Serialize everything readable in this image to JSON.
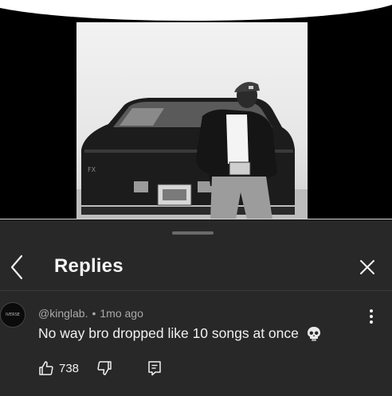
{
  "video": {
    "plate_text": "FX"
  },
  "header": {
    "title": "Replies",
    "back_icon": "chevron-left-icon",
    "close_icon": "close-icon"
  },
  "comment": {
    "avatar_text": "IVERSE",
    "author": "@kinglab.",
    "separator": "•",
    "time": "1mo ago",
    "text": "No way bro dropped like 10 songs at once",
    "emoji_icon": "skull-icon",
    "likes": "738",
    "more_icon": "more-vertical-icon"
  },
  "colors": {
    "panel_bg": "#282828",
    "text_primary": "#f1f1f1",
    "text_secondary": "#aaaaaa"
  }
}
